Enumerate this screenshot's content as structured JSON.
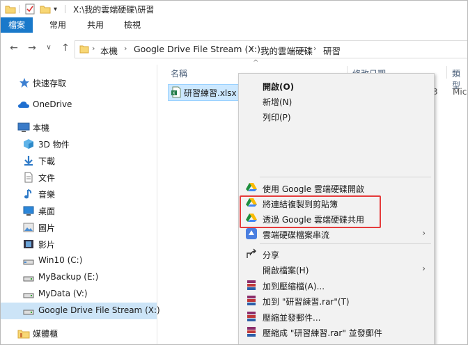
{
  "titlebar": {
    "path": "X:\\我的雲端硬碟\\研習"
  },
  "ribbon": {
    "tabs": [
      "檔案",
      "常用",
      "共用",
      "檢視"
    ]
  },
  "address": {
    "crumbs": [
      "本機",
      "Google Drive File Stream (X:)",
      "我的雲端硬碟",
      "研習"
    ]
  },
  "nav": {
    "items": [
      {
        "label": "快速存取",
        "icon": "star-icon"
      },
      {
        "label": "OneDrive",
        "icon": "cloud-icon"
      },
      {
        "label": "本機",
        "icon": "computer-icon"
      },
      {
        "label": "3D 物件",
        "icon": "cube-icon"
      },
      {
        "label": "下載",
        "icon": "download-icon"
      },
      {
        "label": "文件",
        "icon": "document-icon"
      },
      {
        "label": "音樂",
        "icon": "music-icon"
      },
      {
        "label": "桌面",
        "icon": "desktop-icon"
      },
      {
        "label": "圖片",
        "icon": "picture-icon"
      },
      {
        "label": "影片",
        "icon": "video-icon"
      },
      {
        "label": "Win10 (C:)",
        "icon": "drive-icon"
      },
      {
        "label": "MyBackup (E:)",
        "icon": "drive-icon"
      },
      {
        "label": "MyData (V:)",
        "icon": "drive-icon"
      },
      {
        "label": "Google Drive File Stream (X:)",
        "icon": "drive-icon"
      },
      {
        "label": "媒體櫃",
        "icon": "library-icon"
      }
    ]
  },
  "list": {
    "columns": [
      "名稱",
      "修改日期",
      "類型"
    ],
    "file": {
      "name": "研習練習.xlsx",
      "partial_size": "3",
      "partial_type": "Mic"
    }
  },
  "menu": {
    "items": [
      {
        "label": "開啟(O)",
        "bold": true
      },
      {
        "label": "新增(N)"
      },
      {
        "label": "列印(P)"
      },
      {
        "label": "使用 Google 雲端硬碟開啟",
        "icon": "google-drive-icon"
      },
      {
        "label": "將連結複製到剪貼簿",
        "icon": "google-drive-icon"
      },
      {
        "label": "透過 Google 雲端硬碟共用",
        "icon": "google-drive-icon"
      },
      {
        "label": "雲端硬碟檔案串流",
        "icon": "drive-stream-icon",
        "submenu": true
      },
      {
        "label": "分享",
        "icon": "share-icon"
      },
      {
        "label": "開啟檔案(H)",
        "submenu": true
      },
      {
        "label": "加到壓縮檔(A)...",
        "icon": "winrar-icon"
      },
      {
        "label": "加到 \"研習練習.rar\"(T)",
        "icon": "winrar-icon"
      },
      {
        "label": "壓縮並發郵件...",
        "icon": "winrar-icon"
      },
      {
        "label": "壓縮成 \"研習練習.rar\" 並發郵件",
        "icon": "winrar-icon"
      }
    ]
  },
  "colors": {
    "accent": "#1979ca",
    "selection": "#cce4f7",
    "highlight_box": "#e53b3b"
  }
}
